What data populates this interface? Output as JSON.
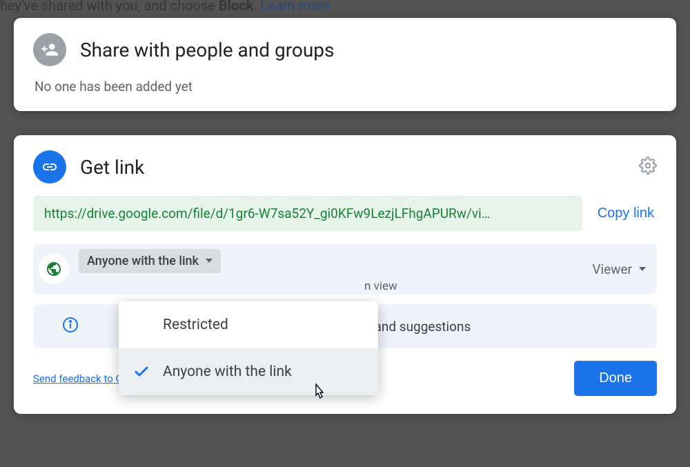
{
  "background": {
    "text_prefix": "hey've shared with you, and choose ",
    "block": "Block",
    "period": ". ",
    "learn_more": "Learn more"
  },
  "share_card": {
    "title": "Share with people and groups",
    "subtitle": "No one has been added yet"
  },
  "link_card": {
    "title": "Get link",
    "url": "https://drive.google.com/file/d/1gr6-W7sa52Y_gi0KFw9LezjLFhgAPURw/vi…",
    "copy_label": "Copy link",
    "access_dropdown": "Anyone with the link",
    "access_sub": "n view",
    "role": "Viewer",
    "info_text": "s and suggestions",
    "feedback": "Send feedback to Google",
    "done": "Done"
  },
  "dropdown": {
    "option_restricted": "Restricted",
    "option_anyone": "Anyone with the link"
  }
}
